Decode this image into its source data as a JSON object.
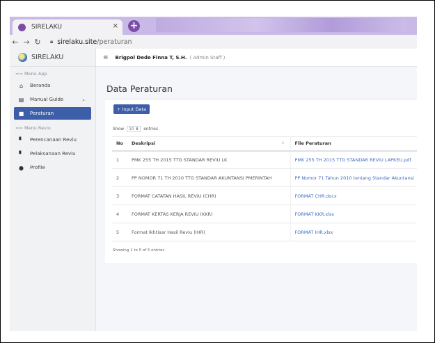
{
  "browser": {
    "tab_title": "SIRELAKU",
    "tab_close": "×",
    "new_tab": "+",
    "url_host": "sirelaku.site",
    "url_path": "/peraturan",
    "icons": {
      "back": "back-arrow-icon",
      "forward": "forward-arrow-icon",
      "reload": "reload-icon",
      "lock": "lock-icon"
    }
  },
  "sidebar": {
    "brand": "SIRELAKU",
    "sections": [
      {
        "title": "== Menu App",
        "items": [
          {
            "label": "Beranda",
            "icon": "home-icon",
            "glyph": "⌂"
          },
          {
            "label": "Manual Guide",
            "icon": "book-icon",
            "glyph": "▤",
            "chevron": "⌄"
          },
          {
            "label": "Peraturan",
            "icon": "bookmark-icon",
            "glyph": "■",
            "active": true
          }
        ]
      },
      {
        "title": "== Menu Reviu",
        "items": [
          {
            "label": "Perencanaan Reviu",
            "icon": "file-icon",
            "glyph": "▘"
          },
          {
            "label": "Pelaksanaan Reviu",
            "icon": "file-icon",
            "glyph": "▘"
          },
          {
            "label": "Profile",
            "icon": "user-icon",
            "glyph": "●"
          }
        ]
      }
    ]
  },
  "topbar": {
    "menu_icon": "≡",
    "user_name": "Brigpol Dede Finna T, S.H.",
    "role": "( Admin Staff )"
  },
  "main": {
    "page_title": "Data Peraturan",
    "input_button": "+ Input Data",
    "show_label": "Show",
    "show_value": "10",
    "entries_label": "entries",
    "columns": [
      "No",
      "Deskripsi",
      "File Peraturan"
    ],
    "rows": [
      {
        "no": "1",
        "desc": "PMK 255 TH 2015 TTG STANDAR REVIU LK",
        "file": "PMK 255 TH 2015 TTG STANDAR REVIU LAPKEU.pdf"
      },
      {
        "no": "2",
        "desc": "PP NOMOR 71 TH 2010 TTG STANDAR AKUNTANSI PMERINTAH",
        "file": "PP Nomor 71 Tahun 2010 tentang Standar Akuntansi"
      },
      {
        "no": "3",
        "desc": "FORMAT CATATAN HASIL REVIU (CHR)",
        "file": "FORMAT CHR.docx"
      },
      {
        "no": "4",
        "desc": "FORMAT KERTAS KERJA REVIU (KKR)",
        "file": "FORMAT KKR.xlsx"
      },
      {
        "no": "5",
        "desc": "Format Ikhtisar Hasil Reviu (IHR)",
        "file": "FORMAT IHR.xlsx"
      }
    ],
    "footer_info": "Showing 1 to 5 of 5 entries"
  },
  "colors": {
    "accent": "#3d5ea8",
    "link": "#3d6cc1",
    "tabbar": "#c9b9e6"
  }
}
